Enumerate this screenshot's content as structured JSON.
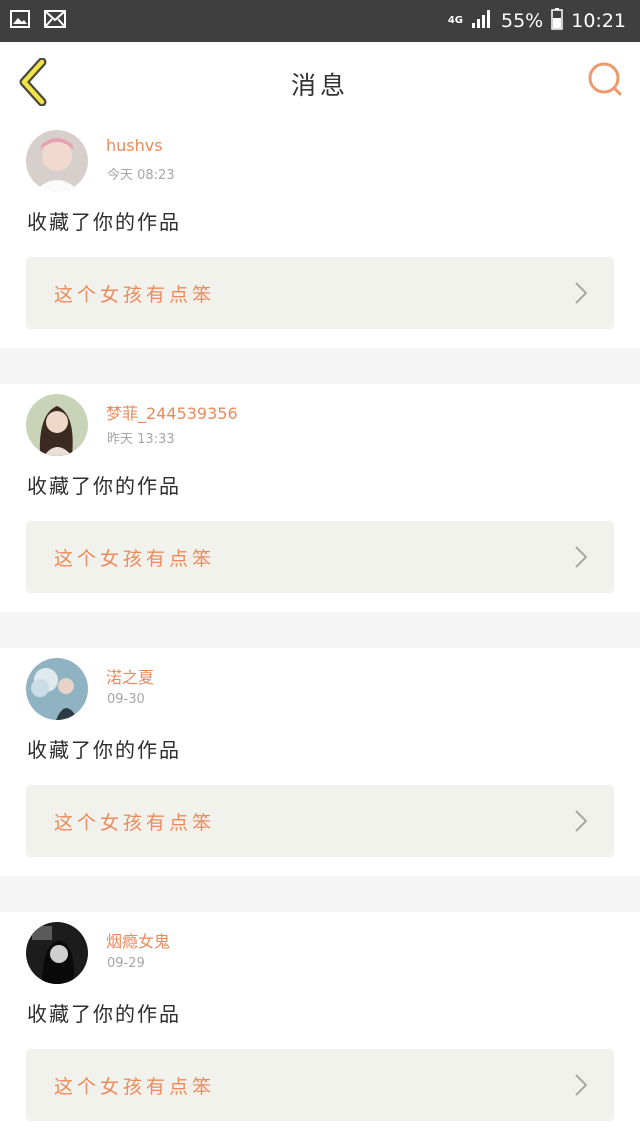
{
  "status_bar": {
    "network": "4G",
    "battery": "55%",
    "time": "10:21",
    "icons": [
      "gallery-icon",
      "mail-icon",
      "signal-icon",
      "battery-icon"
    ]
  },
  "header": {
    "title": "消息",
    "back_icon": "chevron-left-icon",
    "search_icon": "search-icon"
  },
  "accent_color": "#ec8a5c",
  "messages": [
    {
      "user": "hushvs",
      "time": "今天  08:23",
      "action": "收藏了你的作品",
      "work_title": "这个女孩有点笨"
    },
    {
      "user": "梦菲_244539356",
      "time": "昨天  13:33",
      "action": "收藏了你的作品",
      "work_title": "这个女孩有点笨"
    },
    {
      "user": "渃之夏",
      "time": "09-30",
      "action": "收藏了你的作品",
      "work_title": "这个女孩有点笨"
    },
    {
      "user": "烟瘾女鬼",
      "time": "09-29",
      "action": "收藏了你的作品",
      "work_title": "这个女孩有点笨"
    }
  ]
}
